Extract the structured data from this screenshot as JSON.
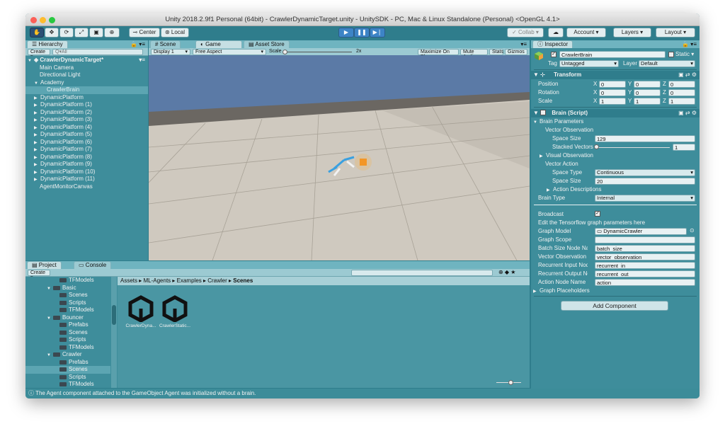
{
  "window": {
    "title": "Unity 2018.2.9f1 Personal (64bit) - CrawlerDynamicTarget.unity - UnitySDK - PC, Mac & Linux Standalone (Personal) <OpenGL 4.1>"
  },
  "toolbar": {
    "pivot": "Center",
    "space": "Local",
    "collab": "Collab",
    "account": "Account",
    "layers": "Layers",
    "layout": "Layout"
  },
  "hierarchy": {
    "tab": "Hierarchy",
    "create": "Create",
    "search_placeholder": "Q▾All",
    "scene": "CrawlerDynamicTarget*",
    "items": [
      "Main Camera",
      "Directional Light",
      "Academy",
      "CrawlerBrain",
      "DynamicPlatform",
      "DynamicPlatform (1)",
      "DynamicPlatform (2)",
      "DynamicPlatform (3)",
      "DynamicPlatform (4)",
      "DynamicPlatform (5)",
      "DynamicPlatform (6)",
      "DynamicPlatform (7)",
      "DynamicPlatform (8)",
      "DynamicPlatform (9)",
      "DynamicPlatform (10)",
      "DynamicPlatform (11)",
      "AgentMonitorCanvas"
    ]
  },
  "game_view": {
    "tabs": [
      "Scene",
      "Game",
      "Asset Store"
    ],
    "display": "Display 1",
    "aspect": "Free Aspect",
    "scale_label": "Scale",
    "scale_value": "2x",
    "options": [
      "Maximize On Play",
      "Mute Audio",
      "Stats",
      "Gizmos"
    ]
  },
  "project": {
    "tabs": [
      "Project",
      "Console"
    ],
    "create": "Create",
    "tree": [
      "TFModels",
      "Basic",
      "Scenes",
      "Scripts",
      "TFModels",
      "Bouncer",
      "Prefabs",
      "Scenes",
      "Scripts",
      "TFModels",
      "Crawler",
      "Prefabs",
      "Scenes",
      "Scripts",
      "TFModels"
    ],
    "breadcrumb": [
      "Assets",
      "ML-Agents",
      "Examples",
      "Crawler",
      "Scenes"
    ],
    "assets": [
      "CrawlerDyna...",
      "CrawlerStatic..."
    ]
  },
  "status": {
    "message": "The Agent component attached to the GameObject Agent was initialized without a brain."
  },
  "inspector": {
    "tab": "Inspector",
    "object_name": "CrawlerBrain",
    "static_label": "Static",
    "tag_label": "Tag",
    "tag_value": "Untagged",
    "layer_label": "Layer",
    "layer_value": "Default",
    "transform": {
      "title": "Transform",
      "position_label": "Position",
      "rotation_label": "Rotation",
      "scale_label": "Scale",
      "position": [
        "0",
        "0",
        "0"
      ],
      "rotation": [
        "0",
        "0",
        "0"
      ],
      "scale": [
        "1",
        "1",
        "1"
      ],
      "axes": [
        "X",
        "Y",
        "Z"
      ]
    },
    "brain": {
      "title": "Brain (Script)",
      "brain_parameters": "Brain Parameters",
      "vector_observation": "Vector Observation",
      "space_size_label": "Space Size",
      "space_size": "129",
      "stacked_vectors_label": "Stacked Vectors",
      "stacked_vectors": "1",
      "visual_observation": "Visual Observation",
      "vector_action": "Vector Action",
      "space_type_label": "Space Type",
      "space_type": "Continuous",
      "action_space_size_label": "Space Size",
      "action_space_size": "20",
      "action_descriptions": "Action Descriptions",
      "brain_type_label": "Brain Type",
      "brain_type": "Internal",
      "broadcast_label": "Broadcast",
      "edit_label": "Edit the Tensorflow graph parameters here",
      "graph_model_label": "Graph Model",
      "graph_model": "DynamicCrawler",
      "graph_scope_label": "Graph Scope",
      "graph_scope": "",
      "batch_size_label": "Batch Size Node Name",
      "batch_size": "batch_size",
      "vector_obs_label": "Vector Observation Nc",
      "vector_obs": "vector_observation",
      "recurrent_in_label": "Recurrent Input Node",
      "recurrent_in": "recurrent_in",
      "recurrent_out_label": "Recurrent Output Nod",
      "recurrent_out": "recurrent_out",
      "action_node_label": "Action Node Name",
      "action_node": "action",
      "graph_placeholders": "Graph Placeholders"
    },
    "add_component": "Add Component"
  }
}
